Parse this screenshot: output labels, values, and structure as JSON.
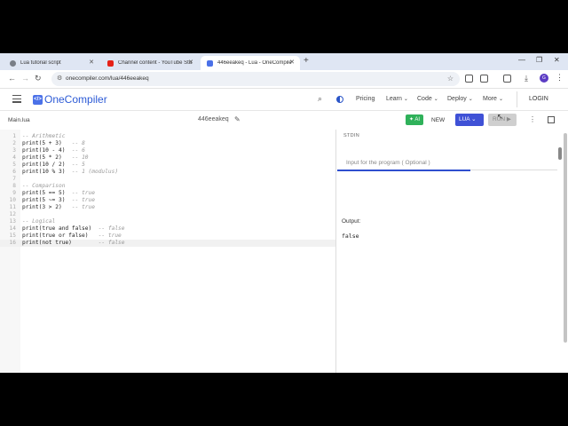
{
  "browser": {
    "tabs": [
      {
        "title": "Lua tutorial script",
        "icon": "globe-icon",
        "color": "#5f6368"
      },
      {
        "title": "Channel content - YouTube Stu",
        "icon": "youtube-icon",
        "color": "#e62117"
      },
      {
        "title": "446eeakeq - Lua - OneCompile",
        "icon": "onecompiler-icon",
        "color": "#4b71e8"
      }
    ],
    "new_tab": "+",
    "url": "onecompiler.com/lua/446eeakeq"
  },
  "app": {
    "logo_mark": "</>",
    "logo_text": "OneCompiler",
    "nav": [
      "Pricing",
      "Learn",
      "Code",
      "Deploy",
      "More"
    ],
    "login": "LOGIN",
    "brand_color": "#2d5bd6"
  },
  "toolbar": {
    "filename": "Main.lua",
    "program_name": "446eeakeq",
    "ai_label": "AI",
    "new_label": "NEW",
    "language": "LUA",
    "run_label": "RUN"
  },
  "editor": {
    "lines": [
      {
        "n": "1",
        "code": "",
        "comment": "-- Arithmetic"
      },
      {
        "n": "2",
        "code": "print(5 + 3)   ",
        "comment": "-- 8"
      },
      {
        "n": "3",
        "code": "print(10 - 4)  ",
        "comment": "-- 6"
      },
      {
        "n": "4",
        "code": "print(5 * 2)   ",
        "comment": "-- 10"
      },
      {
        "n": "5",
        "code": "print(10 / 2)  ",
        "comment": "-- 5"
      },
      {
        "n": "6",
        "code": "print(10 % 3)  ",
        "comment": "-- 1 (modulus)"
      },
      {
        "n": "7",
        "code": "",
        "comment": ""
      },
      {
        "n": "8",
        "code": "",
        "comment": "-- Comparison"
      },
      {
        "n": "9",
        "code": "print(5 == 5)  ",
        "comment": "-- true"
      },
      {
        "n": "10",
        "code": "print(5 ~= 3)  ",
        "comment": "-- true"
      },
      {
        "n": "11",
        "code": "print(3 > 2)   ",
        "comment": "-- true"
      },
      {
        "n": "12",
        "code": "",
        "comment": ""
      },
      {
        "n": "13",
        "code": "",
        "comment": "-- Logical"
      },
      {
        "n": "14",
        "code": "print(true and false)  ",
        "comment": "-- false"
      },
      {
        "n": "15",
        "code": "print(true or false)   ",
        "comment": "-- true"
      },
      {
        "n": "16",
        "code": "print(not true)        ",
        "comment": "-- false"
      }
    ]
  },
  "stdin": {
    "label": "STDIN",
    "placeholder": "Input for the program ( Optional )"
  },
  "output": {
    "label": "Output:",
    "value": "false"
  }
}
